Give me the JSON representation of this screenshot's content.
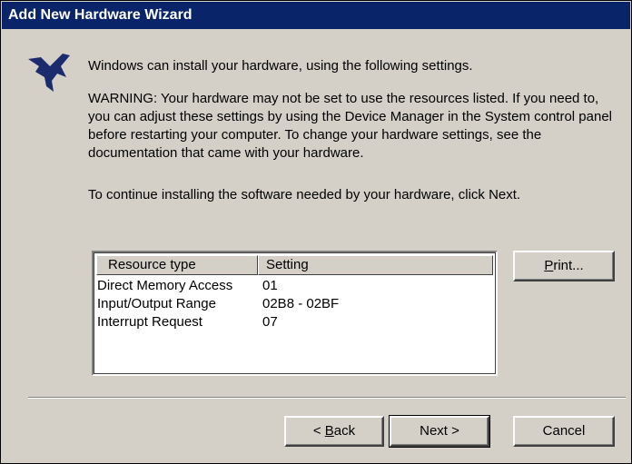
{
  "window": {
    "title": "Add New Hardware Wizard"
  },
  "messages": {
    "intro": "Windows can install your hardware, using the following settings.",
    "warning": "WARNING:  Your hardware may not be set to use the resources listed. If you need to, you can adjust these settings by using the Device Manager in the System control panel before restarting your computer. To change your hardware settings, see the documentation that came with your hardware.",
    "continue": "To continue installing the software needed by your hardware, click Next."
  },
  "resources": {
    "columns": [
      "Resource type",
      "Setting"
    ],
    "rows": [
      [
        "Direct Memory Access",
        "01"
      ],
      [
        "Input/Output Range",
        "02B8 - 02BF"
      ],
      [
        "Interrupt Request",
        "07"
      ]
    ]
  },
  "buttons": {
    "print_mnemonic": "P",
    "print_rest": "rint...",
    "back_prefix": "< ",
    "back_mnemonic": "B",
    "back_rest": "ack",
    "next": "Next >",
    "cancel": "Cancel"
  },
  "icons": {
    "logo": "national-instruments-eagle-icon"
  },
  "colors": {
    "titlebar": "#0a246a",
    "dialog": "#d4d0c8"
  }
}
